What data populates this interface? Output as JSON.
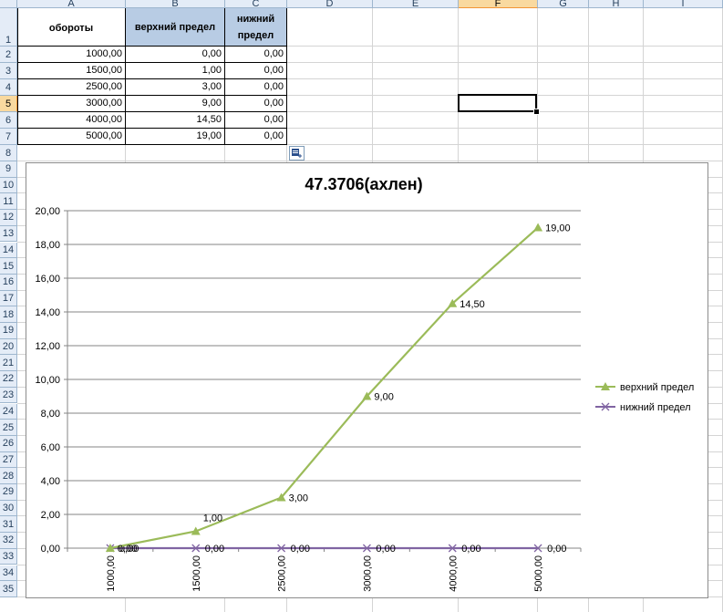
{
  "columns": [
    "A",
    "B",
    "C",
    "D",
    "E",
    "F",
    "G",
    "H",
    "I"
  ],
  "active_column": "F",
  "rows": [
    "1",
    "2",
    "3",
    "4",
    "5",
    "6",
    "7",
    "8",
    "9",
    "10",
    "11",
    "12",
    "13",
    "14",
    "15",
    "16",
    "17",
    "18",
    "19",
    "20",
    "21",
    "22",
    "23",
    "24",
    "25",
    "26",
    "27",
    "28",
    "29",
    "30",
    "31",
    "32",
    "33",
    "34",
    "35"
  ],
  "active_row": "5",
  "table": {
    "headers": [
      "обороты",
      "верхний предел",
      "нижний предел"
    ],
    "header_fill": "#b8cce4",
    "data": [
      [
        "1000,00",
        "0,00",
        "0,00"
      ],
      [
        "1500,00",
        "1,00",
        "0,00"
      ],
      [
        "2500,00",
        "3,00",
        "0,00"
      ],
      [
        "3000,00",
        "9,00",
        "0,00"
      ],
      [
        "4000,00",
        "14,50",
        "0,00"
      ],
      [
        "5000,00",
        "19,00",
        "0,00"
      ]
    ]
  },
  "selected_cell": "F5",
  "icons": {
    "paste_options": "paste-options-icon"
  },
  "chart_data": {
    "type": "line",
    "title": "47.3706(ахлен)",
    "categories": [
      "1000,00",
      "1500,00",
      "2500,00",
      "3000,00",
      "4000,00",
      "5000,00"
    ],
    "series": [
      {
        "name": "верхний предел",
        "values": [
          0,
          1,
          3,
          9,
          14.5,
          19
        ],
        "labels": [
          "0,00",
          "1,00",
          "3,00",
          "9,00",
          "14,50",
          "19,00"
        ],
        "color": "#9bbb59",
        "marker": "triangle"
      },
      {
        "name": "нижний предел",
        "values": [
          0,
          0,
          0,
          0,
          0,
          0
        ],
        "labels": [
          "0,00",
          "0,00",
          "0,00",
          "0,00",
          "0,00",
          "0,00"
        ],
        "color": "#8064a2",
        "marker": "x"
      }
    ],
    "yticks": [
      "0,00",
      "2,00",
      "4,00",
      "6,00",
      "8,00",
      "10,00",
      "12,00",
      "14,00",
      "16,00",
      "18,00",
      "20,00"
    ],
    "ylim": [
      0,
      20
    ],
    "grid": true,
    "legend": "right"
  }
}
